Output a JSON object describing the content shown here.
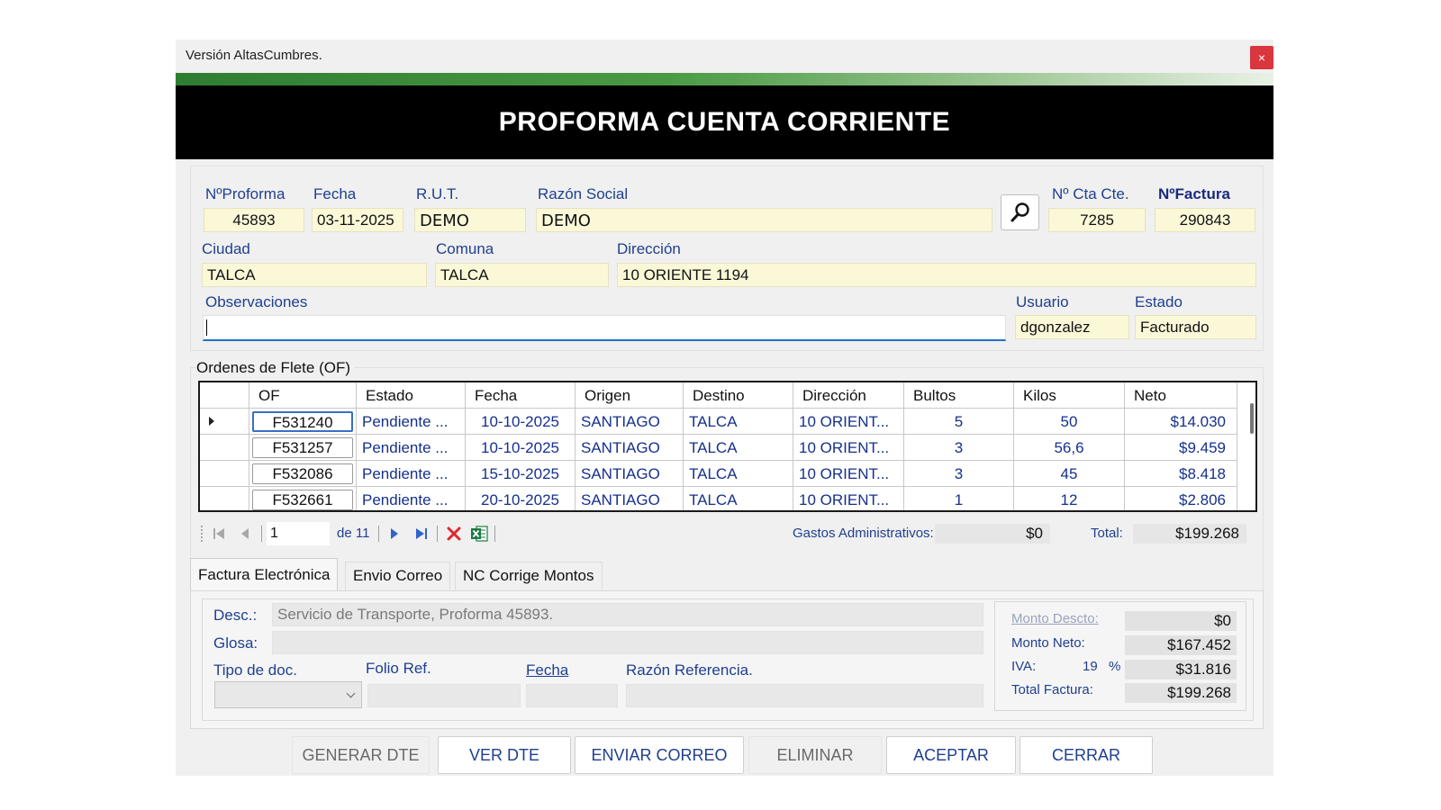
{
  "window": {
    "title": "Versión AltasCumbres.",
    "close_label": "×"
  },
  "header": {
    "title": "PROFORMA CUENTA CORRIENTE"
  },
  "form": {
    "nproforma_label": "NºProforma",
    "nproforma": "45893",
    "fecha_label": "Fecha",
    "fecha": "03-11-2025",
    "rut_label": "R.U.T.",
    "rut": "DEMO",
    "razon_label": "Razón Social",
    "razon": "DEMO",
    "ctacte_label": "Nº Cta Cte.",
    "ctacte": "7285",
    "factura_label": "NºFactura",
    "factura": "290843",
    "ciudad_label": "Ciudad",
    "ciudad": "TALCA",
    "comuna_label": "Comuna",
    "comuna": "TALCA",
    "direccion_label": "Dirección",
    "direccion": "10 ORIENTE 1194",
    "obs_label": "Observaciones",
    "obs": "",
    "usuario_label": "Usuario",
    "usuario": "dgonzalez",
    "estado_label": "Estado",
    "estado": "Facturado"
  },
  "ordenes": {
    "legend": "Ordenes de Flete (OF)",
    "columns": [
      "OF",
      "Estado",
      "Fecha",
      "Origen",
      "Destino",
      "Dirección",
      "Bultos",
      "Kilos",
      "Neto"
    ],
    "rows": [
      [
        "F531240",
        "Pendiente ...",
        "10-10-2025",
        "SANTIAGO",
        "TALCA",
        "10 ORIENT...",
        "5",
        "50",
        "$14.030"
      ],
      [
        "F531257",
        "Pendiente ...",
        "10-10-2025",
        "SANTIAGO",
        "TALCA",
        "10 ORIENT...",
        "3",
        "56,6",
        "$9.459"
      ],
      [
        "F532086",
        "Pendiente ...",
        "15-10-2025",
        "SANTIAGO",
        "TALCA",
        "10 ORIENT...",
        "3",
        "45",
        "$8.418"
      ],
      [
        "F532661",
        "Pendiente ...",
        "20-10-2025",
        "SANTIAGO",
        "TALCA",
        "10 ORIENT...",
        "1",
        "12",
        "$2.806"
      ]
    ]
  },
  "nav": {
    "page": "1",
    "of_pages": "de 11"
  },
  "summary": {
    "gastos_label": "Gastos Administrativos:",
    "gastos": "$0",
    "total_label": "Total:",
    "total": "$199.268"
  },
  "tabs": [
    "Factura Electrónica",
    "Envio Correo",
    "NC Corrige Montos"
  ],
  "factura": {
    "desc_label": "Desc.:",
    "desc": "Servicio de Transporte, Proforma 45893.",
    "glosa_label": "Glosa:",
    "glosa": "",
    "tipodoc_label": "Tipo de doc.",
    "folio_label": "Folio Ref.",
    "fecha_label": "Fecha",
    "razonref_label": "Razón Referencia."
  },
  "totals": {
    "descto_label": "Monto Descto:",
    "descto": "$0",
    "neto_label": "Monto Neto:",
    "neto": "$167.452",
    "iva_label": "IVA:",
    "iva_pct": "19",
    "pct_sign": "%",
    "iva": "$31.816",
    "total_label": "Total Factura:",
    "total": "$199.268"
  },
  "buttons": {
    "generar": "GENERAR DTE",
    "ver": "VER DTE",
    "enviar": "ENVIAR CORREO",
    "eliminar": "ELIMINAR",
    "aceptar": "ACEPTAR",
    "cerrar": "CERRAR"
  }
}
